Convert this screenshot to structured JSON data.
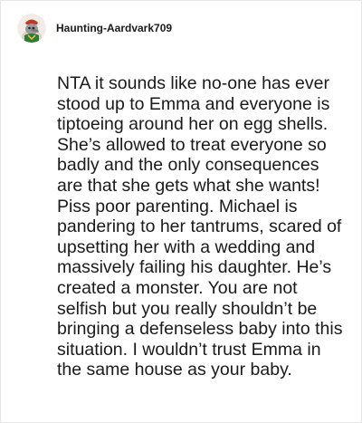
{
  "post": {
    "username": "Haunting-Aardvark709",
    "avatar_icon": "aardvark-avatar-icon",
    "comment_text": "NTA it sounds like no-one has ever stood up to Emma and everyone is tiptoeing around her on egg shells. She’s allowed to treat everyone so badly and the only consequences are that she gets what she wants! Piss poor parenting. Michael is pandering to her tantrums, scared of upsetting her with a wedding and massively failing his daughter. He’s created a monster. You are not selfish but you really shouldn’t be bringing a defenseless baby into this situation. I wouldn’t trust Emma in the same house as your baby."
  },
  "colors": {
    "text": "#1a1a1a",
    "border": "#e6e6e6",
    "background": "#ffffff"
  }
}
